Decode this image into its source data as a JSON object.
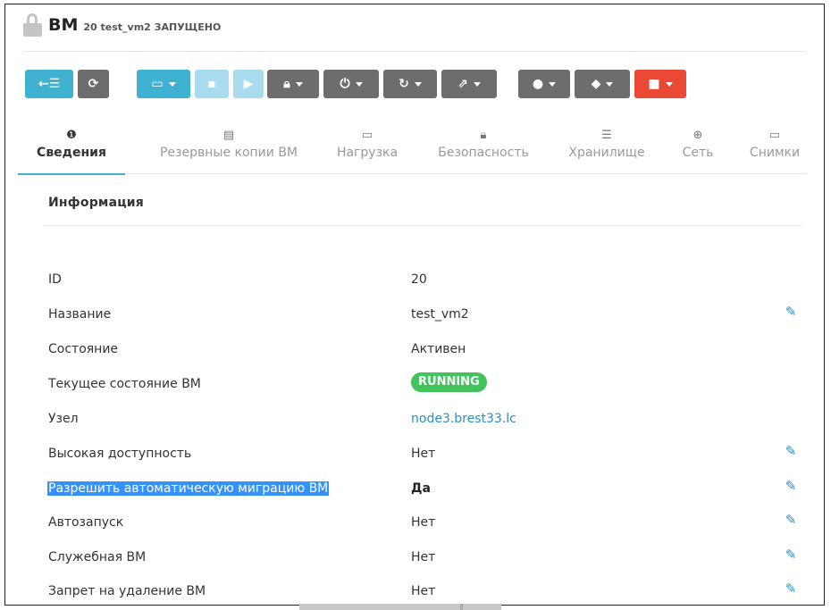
{
  "header": {
    "lock_icon": "unlock-icon",
    "title": "ВМ",
    "subtitle": "20 test_vm2 ЗАПУЩЕНО"
  },
  "toolbar": {
    "colors": {
      "primary": "#3fb2d2",
      "secondary": "#6d6d6d",
      "disabled": "#a9dcee",
      "danger": "#ea4a35"
    },
    "buttons": [
      {
        "name": "back-button",
        "icon": "back-list-icon",
        "glyph": "←☰",
        "dropdown": false
      },
      {
        "name": "refresh-button",
        "icon": "refresh-icon",
        "glyph": "⟳",
        "dropdown": false
      },
      {
        "name": "console-button",
        "icon": "monitor-icon",
        "glyph": "▭",
        "dropdown": true
      },
      {
        "name": "save-button",
        "icon": "save-icon",
        "glyph": "▪",
        "dropdown": false
      },
      {
        "name": "play-button",
        "icon": "play-icon",
        "glyph": "▶",
        "dropdown": false
      },
      {
        "name": "lock-button",
        "icon": "lock-icon",
        "glyph": "🔒︎",
        "dropdown": true
      },
      {
        "name": "power-button",
        "icon": "power-icon",
        "glyph": "⏻",
        "dropdown": true
      },
      {
        "name": "reboot-button",
        "icon": "reboot-icon",
        "glyph": "↻",
        "dropdown": true
      },
      {
        "name": "migrate-button",
        "icon": "share-icon",
        "glyph": "⇗",
        "dropdown": true
      },
      {
        "name": "user-button",
        "icon": "user-icon",
        "glyph": "●",
        "dropdown": true
      },
      {
        "name": "label-button",
        "icon": "tag-icon",
        "glyph": "◆",
        "dropdown": true
      },
      {
        "name": "delete-button",
        "icon": "trash-icon",
        "glyph": "■",
        "dropdown": true
      }
    ]
  },
  "tabs": [
    {
      "label": "Сведения",
      "icon": "info-icon",
      "glyph": "❶",
      "active": true
    },
    {
      "label": "Резервные копии ВМ",
      "icon": "archive-icon",
      "glyph": "▤",
      "active": false
    },
    {
      "label": "Нагрузка",
      "icon": "laptop-icon",
      "glyph": "▭",
      "active": false
    },
    {
      "label": "Безопасность",
      "icon": "lock-icon",
      "glyph": "🔒︎",
      "active": false
    },
    {
      "label": "Хранилище",
      "icon": "storage-icon",
      "glyph": "☰",
      "active": false
    },
    {
      "label": "Сеть",
      "icon": "globe-icon",
      "glyph": "⊕",
      "active": false
    },
    {
      "label": "Снимки",
      "icon": "laptop-icon",
      "glyph": "▭",
      "active": false
    }
  ],
  "info": {
    "title": "Информация",
    "rows": [
      {
        "label": "ID",
        "value": "20",
        "editable": false
      },
      {
        "label": "Название",
        "value": "test_vm2",
        "editable": true
      },
      {
        "label": "Состояние",
        "value": "Активен",
        "editable": false
      },
      {
        "label": "Текущее состояние ВМ",
        "value": "RUNNING",
        "badge": true,
        "badge_color": "#42c35d",
        "editable": false
      },
      {
        "label": "Узел",
        "value": "node3.brest33.lc",
        "link": true,
        "editable": false
      },
      {
        "label": "Высокая доступность",
        "value": "Нет",
        "editable": true
      },
      {
        "label": "Разрешить автоматическую миграцию ВМ",
        "value": "Да",
        "selected": true,
        "editable": true
      },
      {
        "label": "Автозапуск",
        "value": "Нет",
        "editable": true
      },
      {
        "label": "Служебная ВМ",
        "value": "Нет",
        "editable": true
      },
      {
        "label": "Запрет на удаление ВМ",
        "value": "Нет",
        "editable": true
      }
    ]
  }
}
